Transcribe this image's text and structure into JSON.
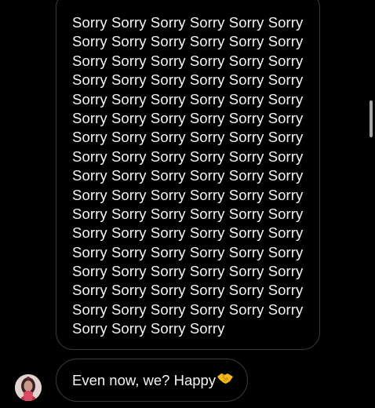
{
  "chat": {
    "messages": [
      {
        "lines": [
          "Sorry Sorry Sorry Sorry Sorry Sorry",
          "Sorry Sorry Sorry Sorry Sorry Sorry",
          "Sorry Sorry Sorry Sorry Sorry Sorry",
          "Sorry Sorry Sorry Sorry Sorry Sorry",
          "Sorry Sorry Sorry Sorry Sorry Sorry",
          "Sorry Sorry Sorry Sorry Sorry Sorry",
          "Sorry Sorry Sorry Sorry Sorry Sorry",
          "Sorry Sorry Sorry Sorry Sorry Sorry",
          "Sorry Sorry Sorry Sorry Sorry Sorry",
          "Sorry Sorry Sorry Sorry Sorry Sorry",
          "Sorry Sorry Sorry Sorry Sorry Sorry",
          "Sorry Sorry Sorry Sorry Sorry Sorry",
          "Sorry Sorry Sorry Sorry Sorry Sorry",
          "Sorry Sorry Sorry Sorry Sorry Sorry",
          "Sorry Sorry Sorry Sorry Sorry Sorry",
          "Sorry Sorry Sorry Sorry Sorry Sorry",
          "Sorry Sorry Sorry Sorry"
        ]
      },
      {
        "text": "Even now, we? Happy",
        "emoji": "handshake-emoji"
      }
    ],
    "sender_avatar": "avatar-photo"
  },
  "colors": {
    "background": "#000000",
    "bubble_border": "#3a3a3c",
    "text": "#f5f5f5",
    "scrollbar": "#a6a6a6",
    "emoji_yellow": "#f5b820"
  }
}
